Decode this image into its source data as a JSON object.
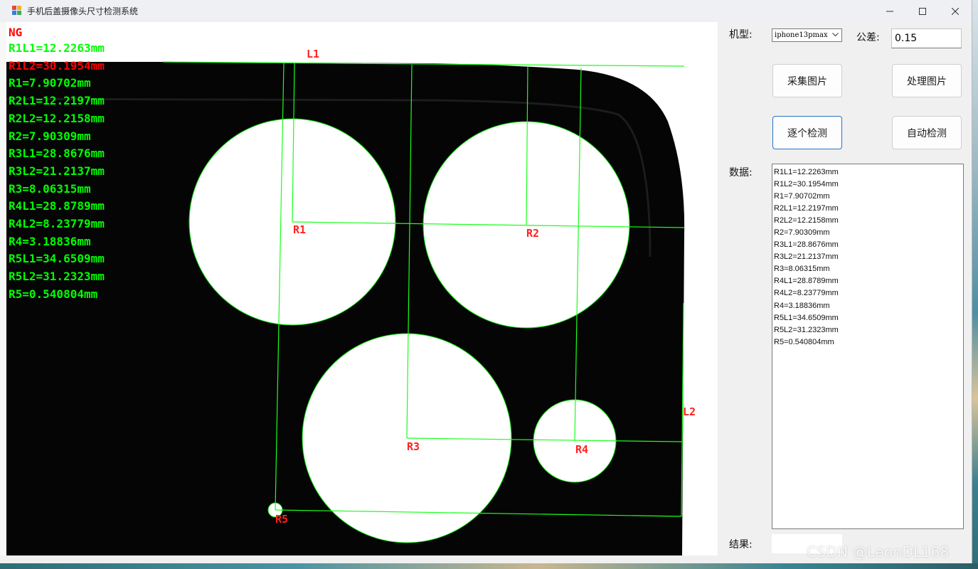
{
  "window": {
    "title": "手机后盖摄像头尺寸检测系统"
  },
  "image": {
    "status": "NG",
    "status_color": "#ff0000",
    "pass_color": "#00ff00",
    "fail_color": "#ff0000",
    "measurements": [
      {
        "text": "R1L1=12.2263mm",
        "ok": true
      },
      {
        "text": "R1L2=30.1954mm",
        "ok": false
      },
      {
        "text": "R1=7.90702mm",
        "ok": true
      },
      {
        "text": "R2L1=12.2197mm",
        "ok": true
      },
      {
        "text": "R2L2=12.2158mm",
        "ok": true
      },
      {
        "text": "R2=7.90309mm",
        "ok": true
      },
      {
        "text": "R3L1=28.8676mm",
        "ok": true
      },
      {
        "text": "R3L2=21.2137mm",
        "ok": true
      },
      {
        "text": "R3=8.06315mm",
        "ok": true
      },
      {
        "text": "R4L1=28.8789mm",
        "ok": true
      },
      {
        "text": "R4L2=8.23779mm",
        "ok": true
      },
      {
        "text": "R4=3.18836mm",
        "ok": true
      },
      {
        "text": "R5L1=34.6509mm",
        "ok": true
      },
      {
        "text": "R5L2=31.2323mm",
        "ok": true
      },
      {
        "text": "R5=0.540804mm",
        "ok": true
      }
    ],
    "labels": {
      "L1": "L1",
      "L2": "L2",
      "R1": "R1",
      "R2": "R2",
      "R3": "R3",
      "R4": "R4",
      "R5": "R5"
    }
  },
  "panel": {
    "model_label": "机型:",
    "model_value": "iphone13pmax",
    "tolerance_label": "公差:",
    "tolerance_value": "0.15",
    "capture_button": "采集图片",
    "process_button": "处理图片",
    "step_button": "逐个检测",
    "auto_button": "自动检测",
    "data_label": "数据:",
    "data_lines": [
      "R1L1=12.2263mm",
      "R1L2=30.1954mm",
      "R1=7.90702mm",
      "R2L1=12.2197mm",
      "R2L2=12.2158mm",
      "R2=7.90309mm",
      "R3L1=28.8676mm",
      "R3L2=21.2137mm",
      "R3=8.06315mm",
      "R4L1=28.8789mm",
      "R4L2=8.23779mm",
      "R4=3.18836mm",
      "R5L1=34.6509mm",
      "R5L2=31.2323mm",
      "R5=0.540804mm"
    ],
    "result_label": "结果:",
    "result_value": ""
  },
  "watermark": "CSDN @LeonDL168"
}
